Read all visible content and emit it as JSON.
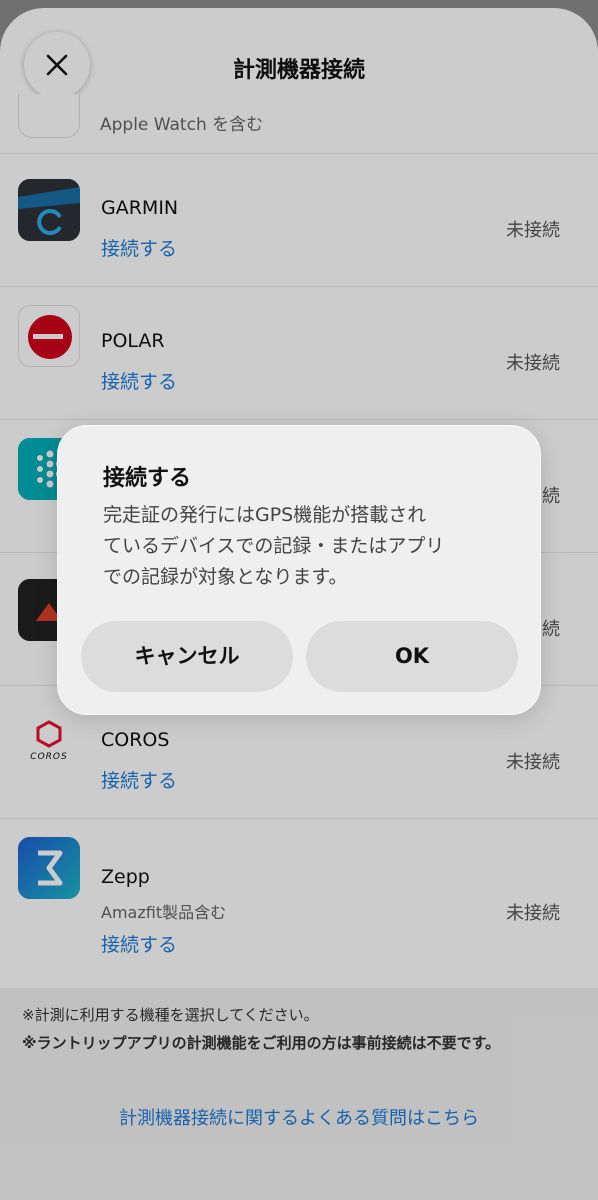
{
  "header": {
    "title": "計測機器接続",
    "close_icon": "close-icon"
  },
  "partial_row": {
    "subtitle": "Apple Watch を含む"
  },
  "devices": [
    {
      "name": "GARMIN",
      "subtitle": "",
      "connect": "接続する",
      "status": "未接続",
      "icon": "garmin-logo-icon"
    },
    {
      "name": "POLAR",
      "subtitle": "",
      "connect": "接続する",
      "status": "未接続",
      "icon": "polar-logo-icon"
    },
    {
      "name": "",
      "subtitle": "",
      "connect": "",
      "status": "続",
      "icon": "fitbit-logo-icon"
    },
    {
      "name": "",
      "subtitle": "",
      "connect": "",
      "status": "続",
      "icon": "suunto-logo-icon"
    },
    {
      "name": "COROS",
      "subtitle": "",
      "connect": "接続する",
      "status": "未接続",
      "icon": "coros-logo-icon",
      "logo_text": "COROS"
    },
    {
      "name": "Zepp",
      "subtitle": "Amazfit製品含む",
      "connect": "接続する",
      "status": "未接続",
      "icon": "zepp-logo-icon"
    }
  ],
  "notes": [
    "※計測に利用する機種を選択してください。",
    "※ラントリップアプリの計測機能をご利用の方は事前接続は不要です。"
  ],
  "faq_link": "計測機器接続に関するよくある質問はこちら",
  "dialog": {
    "title": "接続する",
    "message_lines": [
      "完走証の発行にはGPS機能が搭載され",
      "ているデバイスでの記録・またはアプリ",
      "での記録が対象となります。"
    ],
    "cancel_label": "キャンセル",
    "ok_label": "OK"
  },
  "colors": {
    "link": "#1e7bd6",
    "status": "#555555",
    "overlay": "rgba(0,0,0,0.20)",
    "polar_red": "#d0021b",
    "coros_red": "#e0162b",
    "zepp_blue": "#1a6bd1"
  }
}
